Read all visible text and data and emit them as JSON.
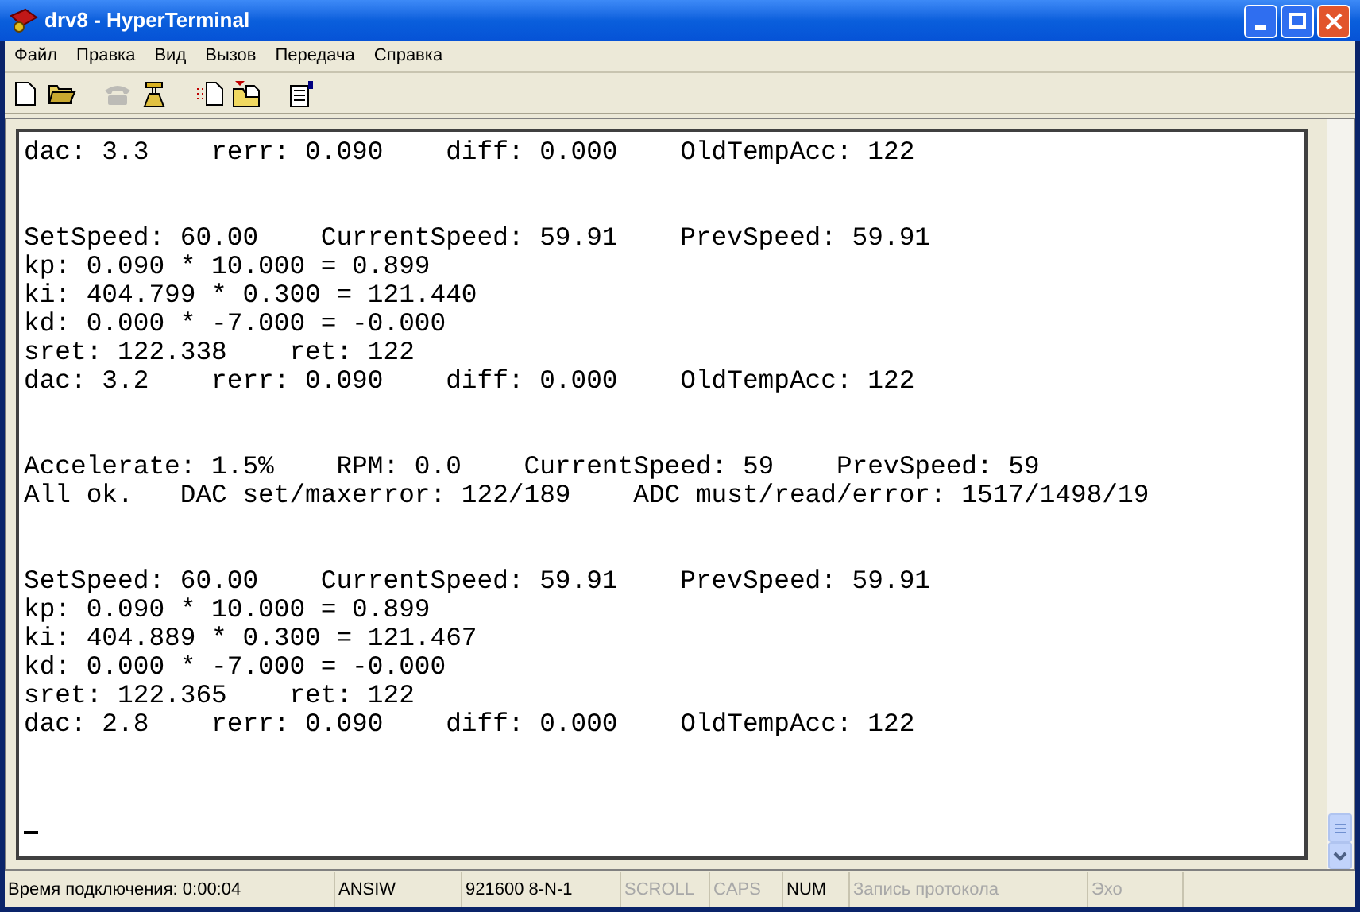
{
  "window": {
    "title": "drv8 - HyperTerminal"
  },
  "menu": [
    "Файл",
    "Правка",
    "Вид",
    "Вызов",
    "Передача",
    "Справка"
  ],
  "toolbar": [
    {
      "kind": "new",
      "disabled": false
    },
    {
      "kind": "open",
      "disabled": false
    },
    {
      "kind": "call",
      "disabled": true
    },
    {
      "kind": "hangup",
      "disabled": false
    },
    {
      "kind": "send",
      "disabled": false
    },
    {
      "kind": "receive",
      "disabled": false
    },
    {
      "kind": "properties",
      "disabled": false
    }
  ],
  "terminal": {
    "blocks": [
      [
        "dac: 3.3    rerr: 0.090    diff: 0.000    OldTempAcc: 122"
      ],
      [
        "SetSpeed: 60.00    CurrentSpeed: 59.91    PrevSpeed: 59.91",
        "kp: 0.090 * 10.000 = 0.899",
        "ki: 404.799 * 0.300 = 121.440",
        "kd: 0.000 * -7.000 = -0.000",
        "sret: 122.338    ret: 122",
        "dac: 3.2    rerr: 0.090    diff: 0.000    OldTempAcc: 122"
      ],
      [
        "Accelerate: 1.5%    RPM: 0.0    CurrentSpeed: 59    PrevSpeed: 59",
        "All ok.   DAC set/maxerror: 122/189    ADC must/read/error: 1517/1498/19"
      ],
      [
        "SetSpeed: 60.00    CurrentSpeed: 59.91    PrevSpeed: 59.91",
        "kp: 0.090 * 10.000 = 0.899",
        "ki: 404.889 * 0.300 = 121.467",
        "kd: 0.000 * -7.000 = -0.000",
        "sret: 122.365    ret: 122",
        "dac: 2.8    rerr: 0.090    diff: 0.000    OldTempAcc: 122"
      ]
    ]
  },
  "status_bar": [
    {
      "text": "Время подключения: 0:00:04",
      "disabled": false
    },
    {
      "text": "ANSIW",
      "disabled": false
    },
    {
      "text": "921600 8-N-1",
      "disabled": false
    },
    {
      "text": "SCROLL",
      "disabled": true
    },
    {
      "text": "CAPS",
      "disabled": true
    },
    {
      "text": "NUM",
      "disabled": false
    },
    {
      "text": "Запись протокола",
      "disabled": true
    },
    {
      "text": "Эхо",
      "disabled": true
    }
  ]
}
